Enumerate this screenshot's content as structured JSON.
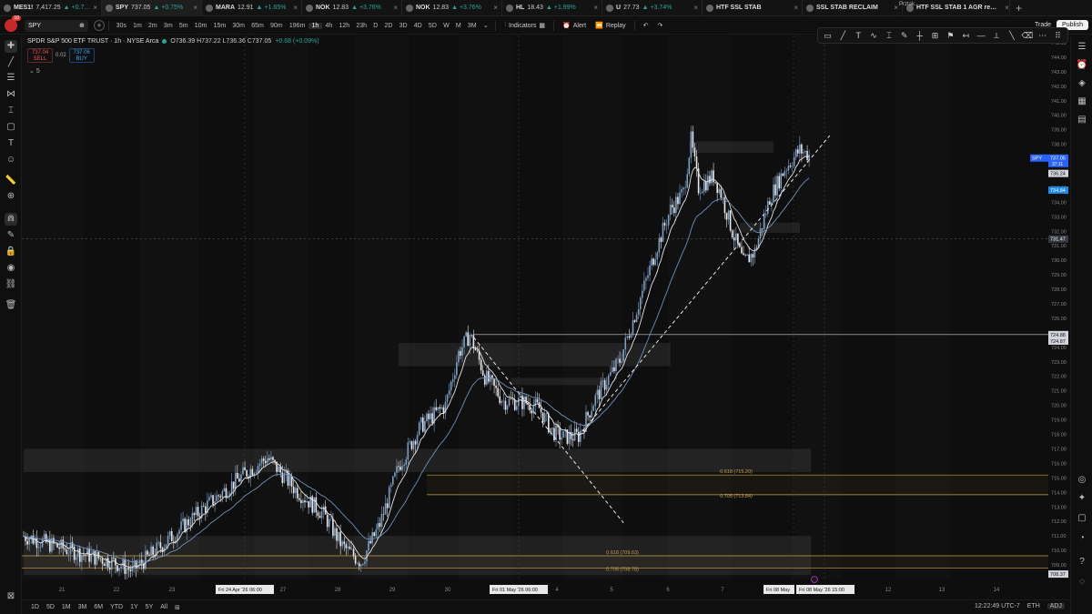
{
  "tabs": [
    {
      "name": "MES1!",
      "price": "7,417.25",
      "change": "▲ +0.7…",
      "active": false
    },
    {
      "name": "SPY",
      "price": "737.05",
      "change": "▲ +0.75%",
      "active": true
    },
    {
      "name": "MARA",
      "price": "12.91",
      "change": "▲ +1.65%",
      "active": false
    },
    {
      "name": "NOK",
      "price": "12.83",
      "change": "▲ +3.76%",
      "active": false
    },
    {
      "name": "NOK",
      "price": "12.83",
      "change": "▲ +3.76%",
      "active": false
    },
    {
      "name": "HL",
      "price": "18.43",
      "change": "▲ +1.99%",
      "active": false
    },
    {
      "name": "U",
      "price": "27.73",
      "change": "▲ +3.74%",
      "active": false
    },
    {
      "name": "HTF SSL STAB",
      "price": "",
      "change": "",
      "active": false
    },
    {
      "name": "SSL STAB RECLAIM",
      "price": "",
      "change": "",
      "active": false
    },
    {
      "name": "HTF SSL STAB 1 AGR re…",
      "price": "",
      "change": "",
      "active": false
    }
  ],
  "toolbar": {
    "logo_badge": "10",
    "symbol": "SPY",
    "timeframes": [
      "30s",
      "1m",
      "2m",
      "3m",
      "5m",
      "10m",
      "15m",
      "30m",
      "65m",
      "90m",
      "196m",
      "1h",
      "4h",
      "12h",
      "23h",
      "D",
      "2D",
      "3D",
      "4D",
      "5D",
      "W",
      "M",
      "3M"
    ],
    "active_timeframe": "1h",
    "indicators_label": "Indicators",
    "alert_label": "Alert",
    "replay_label": "Replay",
    "trade_label": "Trade",
    "publish_label": "Publish",
    "layout_name": "Prztak…"
  },
  "legend": {
    "title": "SPDR S&P 500 ETF TRUST · 1h · NYSE Arca",
    "ohlc": "O736.39 H737.22 L736.36 C737.05",
    "change": "+0.68 (+0.09%)",
    "sell_price": "737.04",
    "sell_label": "SELL",
    "spread": "0.02",
    "buy_price": "737.06",
    "buy_label": "BUY",
    "indicator_count": "5"
  },
  "price_axis": {
    "ticks": [
      "744.00",
      "743.00",
      "742.00",
      "741.00",
      "740.00",
      "739.00",
      "738.00",
      "737.00",
      "736.00",
      "735.00",
      "734.00",
      "733.00",
      "732.00",
      "731.00",
      "730.00",
      "729.00",
      "728.00",
      "727.00",
      "726.00",
      "725.00",
      "724.00",
      "723.00",
      "722.00",
      "721.00",
      "720.00",
      "719.00",
      "718.00",
      "717.00",
      "716.00",
      "715.00",
      "714.00",
      "713.00",
      "712.00",
      "711.00",
      "710.00",
      "709.00"
    ],
    "top_label": "745.00",
    "labels": [
      {
        "text": "SPY",
        "value": "737.05",
        "sub": "37:11",
        "color": "#2962ff"
      },
      {
        "text": "",
        "value": "736.24",
        "color": "#d1d4dc"
      },
      {
        "text": "",
        "value": "734.84",
        "color": "#1e88e5"
      },
      {
        "text": "",
        "value": "731.47",
        "color": "#363a45"
      },
      {
        "text": "",
        "value": "724.88",
        "color": "#d1d4dc"
      },
      {
        "text": "",
        "value": "724.87",
        "color": "#d1d4dc"
      },
      {
        "text": "",
        "value": "708.37",
        "color": "#d1d4dc"
      }
    ]
  },
  "time_axis": {
    "ticks": [
      "21",
      "22",
      "23",
      "27",
      "28",
      "29",
      "30",
      "4",
      "5",
      "6",
      "7",
      "12",
      "13",
      "14"
    ],
    "highlight_labels": [
      "Fri 24 Apr '26   06:00",
      "Fri 01 May '26   06:00",
      "Fri 08 May",
      "Fri 08 May '26   15:00"
    ]
  },
  "fib_labels": [
    "0.618 (715.20)",
    "0.705 (713.84)",
    "0.618 (709.63)",
    "0.705 (708.78)"
  ],
  "bottombar": {
    "ranges": [
      "1D",
      "5D",
      "1M",
      "3M",
      "6M",
      "YTD",
      "1Y",
      "5Y",
      "All"
    ],
    "clock": "12:22:49 UTC-7",
    "session": "ETH",
    "adjust": "ADJ"
  },
  "colors": {
    "background": "#0e0e0e",
    "candle_up": "#7b9fc7",
    "candle_down": "#e8e8e8",
    "fib_line": "#c8a14b",
    "price_label_blue": "#2962ff"
  },
  "chart_data": {
    "type": "candlestick",
    "symbol": "SPY",
    "interval": "1h",
    "ylim": [
      708.0,
      745.5
    ],
    "x_sessions": [
      "21",
      "22",
      "23",
      "27",
      "28",
      "29",
      "30",
      "4",
      "5",
      "6",
      "7",
      "12"
    ],
    "swing_path": [
      [
        0,
        711.0
      ],
      [
        12,
        710.5
      ],
      [
        30,
        709.8
      ],
      [
        48,
        709.2
      ],
      [
        58,
        708.6
      ],
      [
        75,
        710.5
      ],
      [
        95,
        712.8
      ],
      [
        118,
        715.3
      ],
      [
        130,
        716.4
      ],
      [
        145,
        714.2
      ],
      [
        160,
        712.5
      ],
      [
        170,
        710.3
      ],
      [
        180,
        709.2
      ],
      [
        190,
        711.8
      ],
      [
        200,
        715.8
      ],
      [
        212,
        718.6
      ],
      [
        225,
        720.0
      ],
      [
        232,
        723.6
      ],
      [
        238,
        724.9
      ],
      [
        246,
        722.0
      ],
      [
        256,
        720.3
      ],
      [
        268,
        720.2
      ],
      [
        275,
        719.8
      ],
      [
        282,
        718.2
      ],
      [
        288,
        717.8
      ],
      [
        296,
        717.9
      ],
      [
        305,
        720.5
      ],
      [
        318,
        723.1
      ],
      [
        328,
        727.0
      ],
      [
        338,
        731.0
      ],
      [
        345,
        733.5
      ],
      [
        352,
        734.7
      ],
      [
        356,
        738.3
      ],
      [
        360,
        735.0
      ],
      [
        368,
        735.8
      ],
      [
        372,
        734.6
      ],
      [
        378,
        732.0
      ],
      [
        384,
        729.8
      ],
      [
        390,
        730.6
      ],
      [
        398,
        734.3
      ],
      [
        406,
        736.3
      ],
      [
        414,
        737.6
      ],
      [
        420,
        737.2
      ]
    ],
    "series": [
      {
        "name": "",
        "kind": "ema_fast",
        "color": "#e6e6e6"
      },
      {
        "name": "",
        "kind": "ema_slow",
        "color": "#6f8fb8"
      }
    ],
    "zones": [
      {
        "from": 738.2,
        "to": 737.4,
        "x_from": 355,
        "x_to": 400
      },
      {
        "from": 724.3,
        "to": 722.7,
        "x_from": 200,
        "x_to": 345
      },
      {
        "from": 721.9,
        "to": 721.4,
        "x_from": 260,
        "x_to": 312
      },
      {
        "from": 732.6,
        "to": 731.9,
        "x_from": 382,
        "x_to": 414
      },
      {
        "from": 717.0,
        "to": 715.4,
        "x_from": 0,
        "x_to": 420
      },
      {
        "from": 711.0,
        "to": 708.3,
        "x_from": 0,
        "x_to": 420
      }
    ],
    "fib_levels": [
      {
        "label": "0.618 (715.20)",
        "value": 715.2
      },
      {
        "label": "0.705 (713.84)",
        "value": 713.84
      },
      {
        "label": "0.618 (709.63)",
        "value": 709.63
      },
      {
        "label": "0.705 (708.78)",
        "value": 708.78
      }
    ],
    "horizontal_lines": [
      724.88,
      731.47
    ],
    "trendlines": [
      {
        "from": [
          296,
          717.9
        ],
        "to": [
          430,
          738.6
        ],
        "style": "dashed"
      },
      {
        "from": [
          240,
          724.7
        ],
        "to": [
          320,
          711.9
        ],
        "style": "dashed"
      }
    ]
  }
}
